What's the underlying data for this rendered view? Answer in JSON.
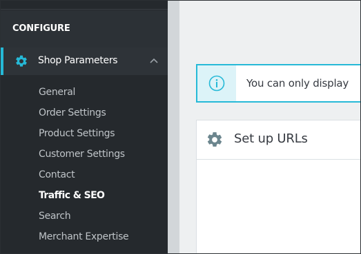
{
  "sidebar": {
    "section_title": "CONFIGURE",
    "active_menu": {
      "label": "Shop Parameters",
      "icon": "gear-icon",
      "expanded_icon": "chevron-up-icon"
    },
    "submenu": [
      {
        "label": "General"
      },
      {
        "label": "Order Settings"
      },
      {
        "label": "Product Settings"
      },
      {
        "label": "Customer Settings"
      },
      {
        "label": "Contact"
      },
      {
        "label": "Traffic & SEO",
        "active": true
      },
      {
        "label": "Search"
      },
      {
        "label": "Merchant Expertise"
      }
    ]
  },
  "main": {
    "alert": {
      "icon": "info-icon",
      "text": "You can only display"
    },
    "card": {
      "icon": "gear-icon",
      "title": "Set up URLs"
    }
  },
  "colors": {
    "accent": "#25b9d7",
    "sidebar_bg": "#25292d",
    "content_bg": "#eef0f1"
  }
}
